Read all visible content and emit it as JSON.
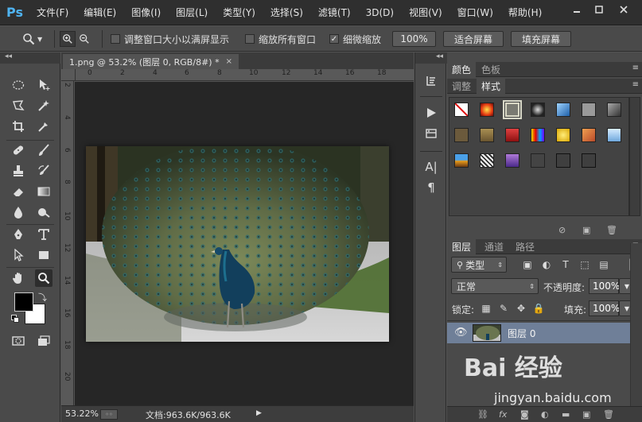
{
  "app": {
    "logo": "Ps"
  },
  "menu": [
    "文件(F)",
    "编辑(E)",
    "图像(I)",
    "图层(L)",
    "类型(Y)",
    "选择(S)",
    "滤镜(T)",
    "3D(D)",
    "视图(V)",
    "窗口(W)",
    "帮助(H)"
  ],
  "options": {
    "resize_windows_label": "调整窗口大小以满屏显示",
    "resize_windows_checked": false,
    "zoom_all_label": "缩放所有窗口",
    "zoom_all_checked": false,
    "scrubby_zoom_label": "细微缩放",
    "scrubby_zoom_checked": true,
    "btn_100": "100%",
    "btn_fit": "适合屏幕",
    "btn_fill": "填充屏幕"
  },
  "document": {
    "tab_title": "1.png @ 53.2% (图层 0, RGB/8#) *",
    "close_glyph": "×",
    "ruler_top": [
      "0",
      "2",
      "4",
      "6",
      "8",
      "10",
      "12",
      "14",
      "16",
      "18"
    ],
    "ruler_left": [
      "2",
      "4",
      "6",
      "8",
      "10",
      "12",
      "14",
      "16",
      "18",
      "20"
    ]
  },
  "status": {
    "zoom": "53.22%",
    "doc_size": "文档:963.6K/963.6K"
  },
  "panels": {
    "color_tabs": [
      "颜色",
      "色板"
    ],
    "adjust_tabs": [
      "调整",
      "样式"
    ],
    "layers_tabs": [
      "图层",
      "通道",
      "路径"
    ],
    "kind_filter": "类型",
    "blend_mode": "正常",
    "opacity_label": "不透明度:",
    "opacity_value": "100%",
    "lock_label": "锁定:",
    "fill_label": "填充:",
    "fill_value": "100%",
    "layer_name": "图层 0"
  },
  "watermark": {
    "logo_text": "Bai 经验",
    "url": "jingyan.baidu.com"
  },
  "colors": {
    "ps_blue": "#4fb3f0",
    "layer_selected": "#6f7f98",
    "foreground": "#000000",
    "background": "#ffffff"
  }
}
